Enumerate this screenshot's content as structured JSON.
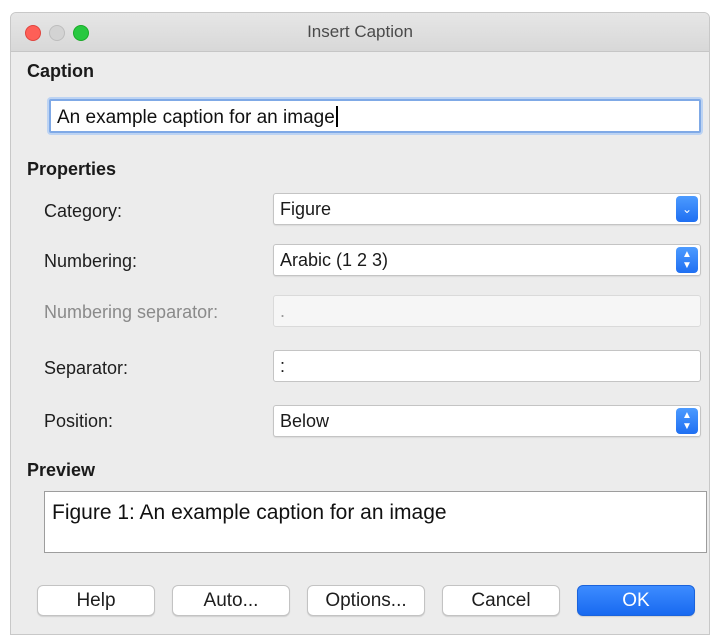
{
  "window": {
    "title": "Insert Caption"
  },
  "caption": {
    "heading": "Caption",
    "value": "An example caption for an image"
  },
  "properties": {
    "heading": "Properties",
    "category": {
      "label": "Category:",
      "value": "Figure"
    },
    "numbering": {
      "label": "Numbering:",
      "value": "Arabic (1 2 3)"
    },
    "numbering_separator": {
      "label": "Numbering separator:",
      "value": "."
    },
    "separator": {
      "label": "Separator:",
      "value": ":"
    },
    "position": {
      "label": "Position:",
      "value": "Below"
    }
  },
  "preview": {
    "heading": "Preview",
    "text": "Figure 1: An example caption for an image"
  },
  "buttons": {
    "help": "Help",
    "auto": "Auto...",
    "options": "Options...",
    "cancel": "Cancel",
    "ok": "OK"
  },
  "colors": {
    "accent": "#1f6ff2",
    "close": "#fe5f57",
    "zoom": "#28c840"
  }
}
